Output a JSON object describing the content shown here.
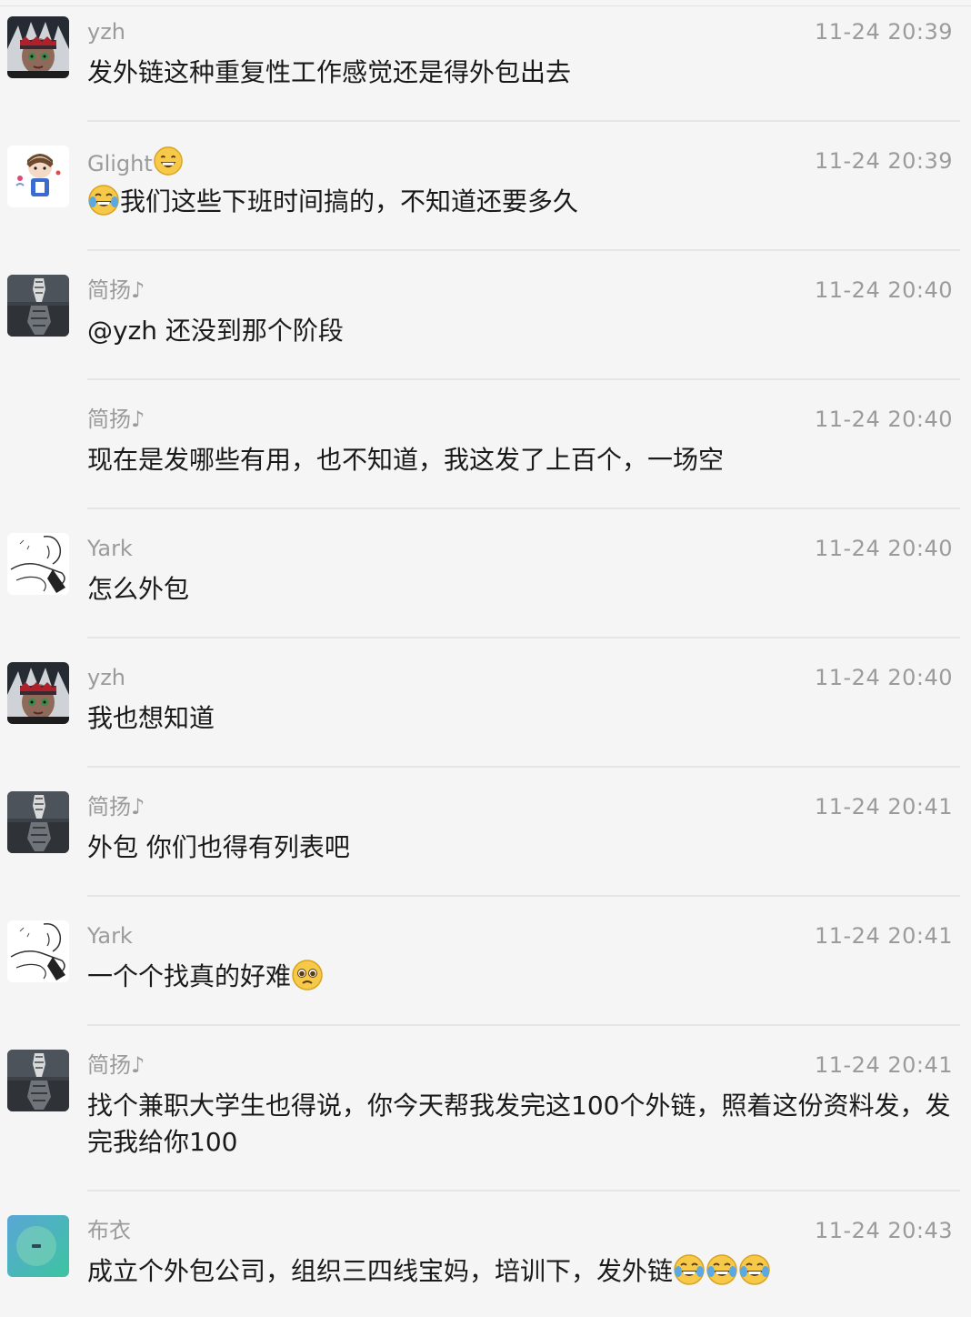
{
  "messages": [
    {
      "sender": "yzh",
      "time": "11-24 20:39",
      "text": "发外链这种重复性工作感觉还是得外包出去",
      "avatar": "yzh-avatar"
    },
    {
      "sender": "Glight",
      "time": "11-24 20:39",
      "text": "我们这些下班时间搞的，不知道还要多久",
      "avatar": "glight-avatar",
      "sender_emoji": "grin-emoji",
      "text_emoji_prefix": "joy-emoji"
    },
    {
      "sender": "简扬♪",
      "time": "11-24 20:40",
      "text": "@yzh 还没到那个阶段",
      "avatar": "tiger-avatar"
    },
    {
      "sender": "简扬♪",
      "time": "11-24 20:40",
      "text": "现在是发哪些有用，也不知道，我这发了上百个，一场空"
    },
    {
      "sender": "Yark",
      "time": "11-24 20:40",
      "text": "怎么外包",
      "avatar": "sketch-avatar"
    },
    {
      "sender": "yzh",
      "time": "11-24 20:40",
      "text": "我也想知道",
      "avatar": "yzh-avatar"
    },
    {
      "sender": "简扬♪",
      "time": "11-24 20:41",
      "text": "外包 你们也得有列表吧",
      "avatar": "tiger-avatar"
    },
    {
      "sender": "Yark",
      "time": "11-24 20:41",
      "text": "一个个找真的好难",
      "avatar": "sketch-avatar",
      "text_emoji_suffix": "pleading-emoji"
    },
    {
      "sender": "简扬♪",
      "time": "11-24 20:41",
      "text": "找个兼职大学生也得说，你今天帮我发完这100个外链，照着这份资料发，发完我给你100",
      "avatar": "tiger-avatar"
    },
    {
      "sender": "布衣",
      "time": "11-24 20:43",
      "text": "成立个外包公司，组织三四线宝妈，培训下，发外链",
      "avatar": "buyi-avatar",
      "text_emoji_suffix": "joy-emoji x3"
    }
  ],
  "colors": {
    "background": "#f5f5f5",
    "meta_text": "#9b9b9b",
    "body_text": "#1a1a1a",
    "divider": "#e6e6e6"
  }
}
